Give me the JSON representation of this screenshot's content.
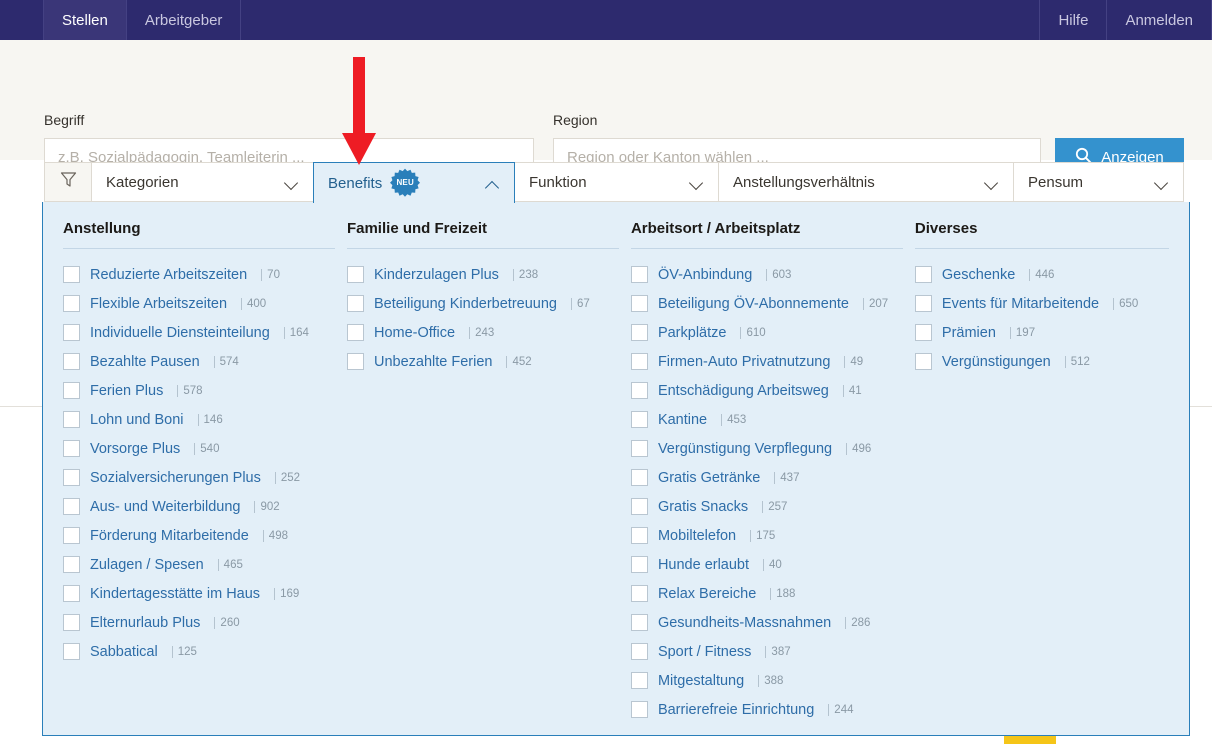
{
  "topnav": {
    "left_tabs": [
      {
        "label": "Stellen",
        "active": true
      },
      {
        "label": "Arbeitgeber",
        "active": false
      }
    ],
    "right_tabs": [
      {
        "label": "Hilfe"
      },
      {
        "label": "Anmelden"
      }
    ],
    "bg_color": "#2d2a6e"
  },
  "search": {
    "term_label": "Begriff",
    "term_placeholder": "z.B. Sozialpädagogin, Teamleiterin ...",
    "term_value": "",
    "region_label": "Region",
    "region_placeholder": "Region oder Kanton wählen ...",
    "region_value": "",
    "submit_label": "Anzeigen",
    "submit_icon": "search-icon",
    "submit_color": "#3492ce"
  },
  "filterbar": {
    "funnel_icon": "filter-funnel-icon",
    "items": [
      {
        "label": "Kategorien",
        "state": "closed",
        "badge": null
      },
      {
        "label": "Benefits",
        "state": "open",
        "badge": "NEU"
      },
      {
        "label": "Funktion",
        "state": "closed",
        "badge": null
      },
      {
        "label": "Anstellungsverhältnis",
        "state": "closed",
        "badge": null
      },
      {
        "label": "Pensum",
        "state": "closed",
        "badge": null
      }
    ],
    "open_accent": "#2a7fba",
    "open_bg": "#e3eff8"
  },
  "benefits_panel": {
    "columns": [
      {
        "title": "Anstellung",
        "options": [
          {
            "label": "Reduzierte Arbeitszeiten",
            "count": "70",
            "checked": false
          },
          {
            "label": "Flexible Arbeitszeiten",
            "count": "400",
            "checked": false
          },
          {
            "label": "Individuelle Diensteinteilung",
            "count": "164",
            "checked": false
          },
          {
            "label": "Bezahlte Pausen",
            "count": "574",
            "checked": false
          },
          {
            "label": "Ferien Plus",
            "count": "578",
            "checked": false
          },
          {
            "label": "Lohn und Boni",
            "count": "146",
            "checked": false
          },
          {
            "label": "Vorsorge Plus",
            "count": "540",
            "checked": false
          },
          {
            "label": "Sozialversicherungen Plus",
            "count": "252",
            "checked": false
          },
          {
            "label": "Aus- und Weiterbildung",
            "count": "902",
            "checked": false
          },
          {
            "label": "Förderung Mitarbeitende",
            "count": "498",
            "checked": false
          },
          {
            "label": "Zulagen / Spesen",
            "count": "465",
            "checked": false
          },
          {
            "label": "Kindertagesstätte im Haus",
            "count": "169",
            "checked": false
          },
          {
            "label": "Elternurlaub Plus",
            "count": "260",
            "checked": false
          },
          {
            "label": "Sabbatical",
            "count": "125",
            "checked": false
          }
        ]
      },
      {
        "title": "Familie und Freizeit",
        "options": [
          {
            "label": "Kinderzulagen Plus",
            "count": "238",
            "checked": false
          },
          {
            "label": "Beteiligung Kinderbetreuung",
            "count": "67",
            "checked": false
          },
          {
            "label": "Home-Office",
            "count": "243",
            "checked": false
          },
          {
            "label": "Unbezahlte Ferien",
            "count": "452",
            "checked": false
          }
        ]
      },
      {
        "title": "Arbeitsort / Arbeitsplatz",
        "options": [
          {
            "label": "ÖV-Anbindung",
            "count": "603",
            "checked": false
          },
          {
            "label": "Beteiligung ÖV-Abonnemente",
            "count": "207",
            "checked": false
          },
          {
            "label": "Parkplätze",
            "count": "610",
            "checked": false
          },
          {
            "label": "Firmen-Auto Privatnutzung",
            "count": "49",
            "checked": false
          },
          {
            "label": "Entschädigung Arbeitsweg",
            "count": "41",
            "checked": false
          },
          {
            "label": "Kantine",
            "count": "453",
            "checked": false
          },
          {
            "label": "Vergünstigung Verpflegung",
            "count": "496",
            "checked": false
          },
          {
            "label": "Gratis Getränke",
            "count": "437",
            "checked": false
          },
          {
            "label": "Gratis Snacks",
            "count": "257",
            "checked": false
          },
          {
            "label": "Mobiltelefon",
            "count": "175",
            "checked": false
          },
          {
            "label": "Hunde erlaubt",
            "count": "40",
            "checked": false
          },
          {
            "label": "Relax Bereiche",
            "count": "188",
            "checked": false
          },
          {
            "label": "Gesundheits-Massnahmen",
            "count": "286",
            "checked": false
          },
          {
            "label": "Sport / Fitness",
            "count": "387",
            "checked": false
          },
          {
            "label": "Mitgestaltung",
            "count": "388",
            "checked": false
          },
          {
            "label": "Barrierefreie Einrichtung",
            "count": "244",
            "checked": false
          }
        ]
      },
      {
        "title": "Diverses",
        "options": [
          {
            "label": "Geschenke",
            "count": "446",
            "checked": false
          },
          {
            "label": "Events für Mitarbeitende",
            "count": "650",
            "checked": false
          },
          {
            "label": "Prämien",
            "count": "197",
            "checked": false
          },
          {
            "label": "Vergünstigungen",
            "count": "512",
            "checked": false
          }
        ]
      }
    ]
  },
  "annotation": {
    "arrow_color": "#ee1c24",
    "points_to": "Benefits"
  }
}
